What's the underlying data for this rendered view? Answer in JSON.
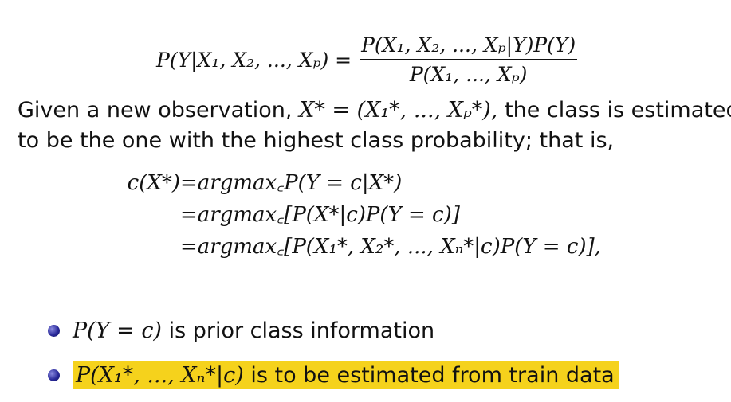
{
  "slide": {
    "bayes_formula": {
      "lhs": "P(Y|X₁, X₂, ..., Xₚ) =",
      "numerator": "P(X₁, X₂, ..., Xₚ|Y)P(Y)",
      "denominator": "P(X₁, ..., Xₚ)"
    },
    "paragraph": {
      "line1_start": "Given a new observation,",
      "line1_math": "X* = (X₁*, ..., Xₚ*),",
      "line1_end": "the class is estimated",
      "line2": "to be the one with the highest class probability; that is,"
    },
    "derivation": {
      "lhs": "c(X*)",
      "row1": "=argmax꜀P(Y = c|X*)",
      "row2": "=argmax꜀[P(X*|c)P(Y = c)]",
      "row3": "=argmax꜀[P(X₁*, X₂*, ..., Xₙ*|c)P(Y = c)],"
    },
    "bullets": [
      {
        "math": "P(Y = c)",
        "text": "is prior class information",
        "highlighted": false
      },
      {
        "math": "P(X₁*, ..., Xₙ*|c)",
        "text": "is to be estimated from train data",
        "highlighted": true
      }
    ],
    "colors": {
      "highlight": "#f5d21c",
      "bullet": "#2a2a9a",
      "text": "#111111"
    }
  }
}
